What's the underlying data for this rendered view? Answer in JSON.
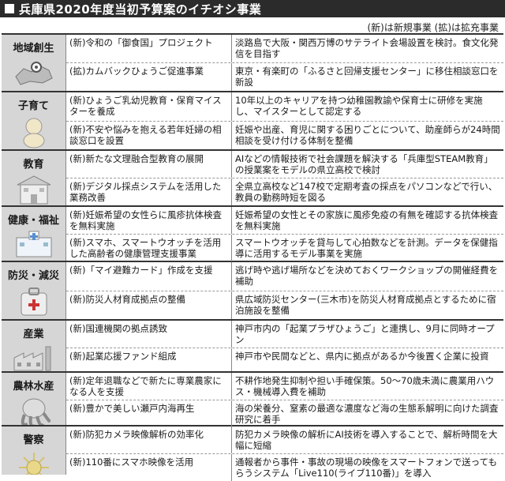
{
  "title": "兵庫県2020年度当初予算案のイチオシ事業",
  "legend": "(新)は新規事業 (拡)は拡充事業",
  "sections": [
    {
      "category": "地域創生",
      "icon": "map-pin-icon",
      "rows": [
        {
          "project": "(新)令和の「御食国」プロジェクト",
          "description": "淡路島で大阪・関西万博のサテライト会場設置を検討。食文化発信を目指す"
        },
        {
          "project": "(拡)カムバックひょうご促進事業",
          "description": "東京・有楽町の「ふるさと回帰支援センター」に移住相談窓口を新設"
        }
      ]
    },
    {
      "category": "子育て",
      "icon": "baby-icon",
      "rows": [
        {
          "project": "(新)ひょうご乳幼児教育・保育マイスターを養成",
          "description": "10年以上のキャリアを持つ幼稚園教諭や保育士に研修を実施し、マイスターとして認定する"
        },
        {
          "project": "(新)不安や悩みを抱える若年妊婦の相談窓口を設置",
          "description": "妊娠や出産、育児に関する困りごとについて、助産師らが24時間相談を受け付ける体制を整備"
        }
      ]
    },
    {
      "category": "教育",
      "icon": "school-building-icon",
      "rows": [
        {
          "project": "(新)新たな文理融合型教育の展開",
          "description": "AIなどの情報技術で社会課題を解決する「兵庫型STEAM教育」の授業案をモデルの県立高校で検討"
        },
        {
          "project": "(新)デジタル採点システムを活用した業務改善",
          "description": "全県立高校など147校で定期考査の採点をパソコンなどで行い、教員の勤務時短を図る"
        }
      ]
    },
    {
      "category": "健康・福祉",
      "icon": "hospital-icon",
      "rows": [
        {
          "project": "(新)妊娠希望の女性らに風疹抗体検査を無料実施",
          "description": "妊娠希望の女性とその家族に風疹免疫の有無を確認する抗体検査を無料実施"
        },
        {
          "project": "(新)スマホ、スマートウオッチを活用した高齢者の健康管理支援事業",
          "description": "スマートウオッチを貸与して心拍数などを計測。データを保健指導に活用するモデル事業を実施"
        }
      ]
    },
    {
      "category": "防災・減災",
      "icon": "emergency-bag-icon",
      "rows": [
        {
          "project": "(新)「マイ避難カード」作成を支援",
          "description": "逃げ時や逃げ場所などを決めておくワークショップの開催経費を補助"
        },
        {
          "project": "(新)防災人材育成拠点の整備",
          "description": "県広域防災センター(三木市)を防災人材育成拠点とするために宿泊施設を整備"
        }
      ]
    },
    {
      "category": "産業",
      "icon": "factory-icon",
      "rows": [
        {
          "project": "(新)国連機関の拠点誘致",
          "description": "神戸市内の「起業プラザひょうご」と連携し、9月に同時オープン"
        },
        {
          "project": "(新)起業応援ファンド組成",
          "description": "神戸市や民間などと、県内に拠点があるか今後置く企業に投資"
        }
      ]
    },
    {
      "category": "農林水産",
      "icon": "octopus-icon",
      "rows": [
        {
          "project": "(新)定年退職などで新たに専業農家になる人を支援",
          "description": "不耕作地発生抑制や担い手確保策。50〜70歳未満に農業用ハウス・機械導入費を補助"
        },
        {
          "project": "(新)豊かで美しい瀬戸内海再生",
          "description": "海の栄養分、窒素の最適な濃度など海の生態系解明に向けた調査研究に着手"
        }
      ]
    },
    {
      "category": "警察",
      "icon": "police-badge-icon",
      "rows": [
        {
          "project": "(新)防犯カメラ映像解析の効率化",
          "description": "防犯カメラ映像の解析にAI技術を導入することで、解析時間を大幅に短縮"
        },
        {
          "project": "(新)110番にスマホ映像を活用",
          "description": "通報者から事件・事故の現場の映像をスマートフォンで送ってもらうシステム「Live110(ライブ110番)」を導入"
        }
      ]
    }
  ]
}
